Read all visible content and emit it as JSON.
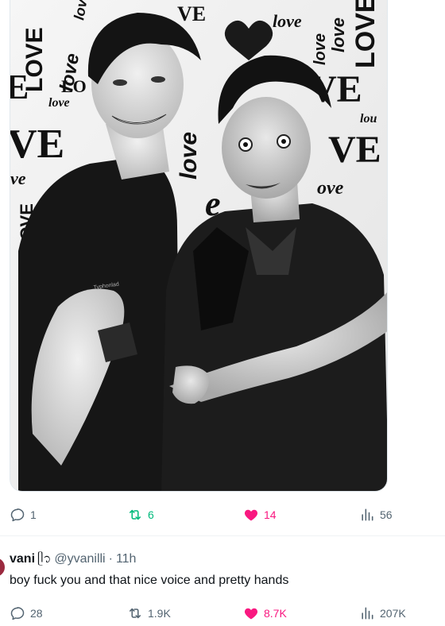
{
  "tweet": {
    "photo": {
      "description_icon": "photo-of-two-men-love-backdrop",
      "backdrop_words": [
        "LOVE",
        "love",
        "love",
        "LOVE",
        "love",
        "VE",
        "ve",
        "love",
        "VE",
        "ove",
        "LOVE",
        "love",
        "LO",
        "lou",
        "lou",
        "E"
      ],
      "watermark": "Typhonlad"
    },
    "actions": {
      "reply_count": "1",
      "retweet_count": "6",
      "like_count": "14",
      "view_count": "56"
    }
  },
  "reply": {
    "name": "vani",
    "emoji": "ᥫ᭡",
    "handle": "@yvanilli",
    "separator": "·",
    "time": "11h",
    "text": "boy fuck you and that nice voice and pretty hands",
    "actions": {
      "reply_count": "28",
      "retweet_count": "1.9K",
      "like_count": "8.7K",
      "view_count": "207K"
    }
  },
  "colors": {
    "text_primary": "#0f1419",
    "text_secondary": "#536471",
    "retweet_active": "#00ba7c",
    "like_active": "#f91880",
    "divider": "#eff3f4"
  }
}
